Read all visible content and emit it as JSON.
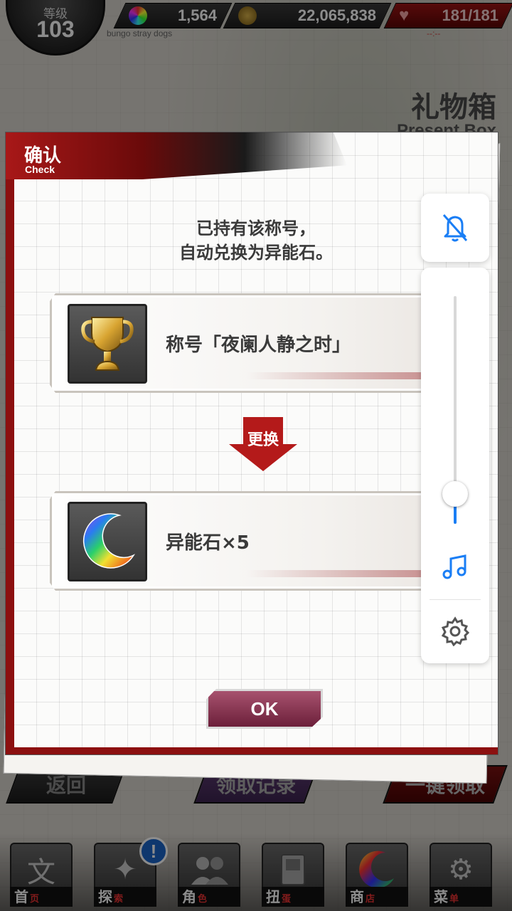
{
  "topbar": {
    "level_label": "等级",
    "level_value": "103",
    "gems": "1,564",
    "coins": "22,065,838",
    "stamina": "181/181",
    "stamina_timer": "--:--",
    "caption": "bungo stray dogs"
  },
  "page": {
    "title": "礼物箱",
    "subtitle": "Present Box"
  },
  "background_buttons": {
    "back": "返回",
    "history": "领取记录",
    "claim_all": "一键领取"
  },
  "bottom_nav": {
    "items": [
      {
        "label": "首",
        "sub": "页",
        "icon": "home-icon"
      },
      {
        "label": "探",
        "sub": "索",
        "icon": "explore-icon"
      },
      {
        "label": "角",
        "sub": "色",
        "icon": "characters-icon"
      },
      {
        "label": "扭",
        "sub": "蛋",
        "icon": "gacha-icon"
      },
      {
        "label": "商",
        "sub": "店",
        "icon": "shop-icon"
      },
      {
        "label": "菜",
        "sub": "单",
        "icon": "menu-gear-icon"
      }
    ],
    "badge": "!"
  },
  "dialog": {
    "title": "确认",
    "title_en": "Check",
    "message": "已持有该称号，\n自动兑换为异能石。",
    "original_item": {
      "label": "称号「夜阑人静之时」",
      "icon": "trophy-icon"
    },
    "exchange_label": "更换",
    "new_item": {
      "label": "异能石×5",
      "icon": "rainbow-moon-stone-icon"
    },
    "ok_label": "OK"
  },
  "control_panel": {
    "mute_icon": "bell-slash-icon",
    "volume_level": 0.13,
    "music_icon": "music-note-icon",
    "settings_icon": "gear-icon"
  },
  "colors": {
    "accent_red": "#8c1010",
    "ok_button": "#8a3352",
    "ios_blue": "#1a7ef5"
  }
}
